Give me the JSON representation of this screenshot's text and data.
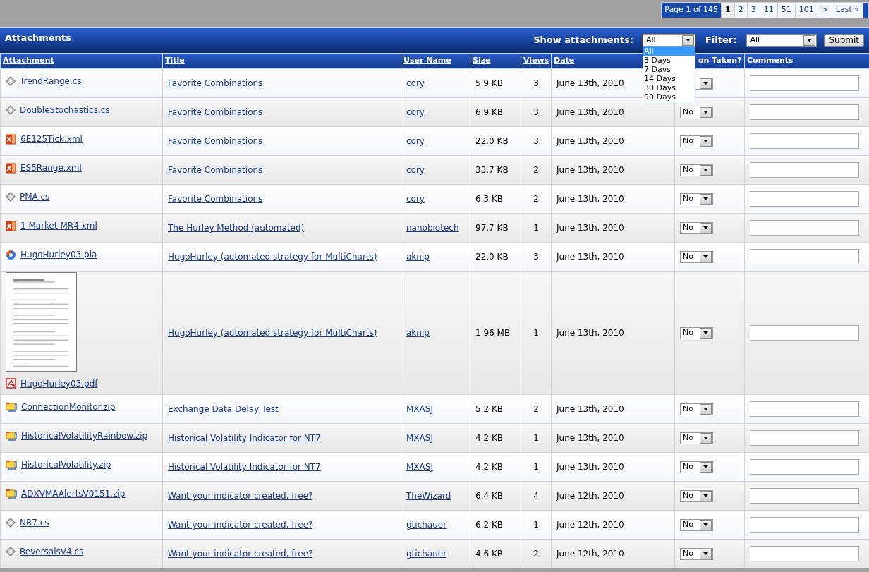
{
  "pagination": {
    "label": "Page 1 of 145",
    "pages": [
      {
        "text": "1",
        "selected": true
      },
      {
        "text": "2",
        "selected": false
      },
      {
        "text": "3",
        "selected": false
      },
      {
        "text": "11",
        "selected": false
      },
      {
        "text": "51",
        "selected": false
      },
      {
        "text": "101",
        "selected": false
      },
      {
        "text": ">",
        "selected": false
      },
      {
        "text": "Last »",
        "selected": false
      }
    ]
  },
  "panel": {
    "title": "Attachments",
    "show_label": "Show attachments:",
    "show_value": "All",
    "show_options": [
      {
        "text": "All",
        "selected": true
      },
      {
        "text": "3 Days",
        "selected": false
      },
      {
        "text": "7 Days",
        "selected": false
      },
      {
        "text": "14 Days",
        "selected": false
      },
      {
        "text": "30 Days",
        "selected": false
      },
      {
        "text": "90 Days",
        "selected": false
      }
    ],
    "filter_label": "Filter:",
    "filter_value": "All",
    "submit": "Submit"
  },
  "table": {
    "columns": [
      {
        "text": "Attachment",
        "link": true
      },
      {
        "text": "Title",
        "link": true
      },
      {
        "text": "User Name",
        "link": true
      },
      {
        "text": "Size",
        "link": true
      },
      {
        "text": "Views",
        "link": true
      },
      {
        "text": "Date",
        "link": true
      },
      {
        "text": "on Taken?",
        "link": false
      },
      {
        "text": "Comments",
        "link": false
      }
    ],
    "rows": [
      {
        "kind": "script",
        "file": "TrendRange.cs",
        "title": "Favorite Combinations",
        "user": "cory",
        "size": "5.9 KB",
        "views": "3",
        "date": "June 13th, 2010"
      },
      {
        "kind": "script",
        "file": "DoubleStochastics.cs",
        "title": "Favorite Combinations",
        "user": "cory",
        "size": "6.9 KB",
        "views": "3",
        "date": "June 13th, 2010",
        "action": "No"
      },
      {
        "kind": "xml",
        "file": "6E125Tick.xml",
        "title": "Favorite Combinations",
        "user": "cory",
        "size": "22.0 KB",
        "views": "3",
        "date": "June 13th, 2010",
        "action": "No"
      },
      {
        "kind": "xml",
        "file": "ES5Range.xml",
        "title": "Favorite Combinations",
        "user": "cory",
        "size": "33.7 KB",
        "views": "2",
        "date": "June 13th, 2010",
        "action": "No"
      },
      {
        "kind": "script",
        "file": "PMA.cs",
        "title": "Favorite Combinations",
        "user": "cory",
        "size": "6.3 KB",
        "views": "2",
        "date": "June 13th, 2010",
        "action": "No"
      },
      {
        "kind": "xml",
        "file": "1 Market MR4.xml",
        "title": "The Hurley Method (automated)",
        "user": "nanobiotech",
        "size": "97.7 KB",
        "views": "1",
        "date": "June 13th, 2010",
        "action": "No"
      },
      {
        "kind": "strategy",
        "file": "HugoHurley03.pla",
        "title": "HugoHurley (automated strategy for MultiCharts)",
        "user": "aknip",
        "size": "22.0 KB",
        "views": "3",
        "date": "June 13th, 2010",
        "action": "No"
      },
      {
        "kind": "pdf",
        "file": "HugoHurley03.pdf",
        "title": "HugoHurley (automated strategy for MultiCharts)",
        "user": "aknip",
        "size": "1.96 MB",
        "views": "1",
        "date": "June 13th, 2010",
        "action": "No"
      },
      {
        "kind": "archive",
        "file": "ConnectionMonitor.zip",
        "title": "Exchange Data Delay Test",
        "user": "MXASJ",
        "size": "5.2 KB",
        "views": "2",
        "date": "June 13th, 2010",
        "action": "No"
      },
      {
        "kind": "archive",
        "file": "HistoricalVolatilityRainbow.zip",
        "title": "Historical Volatility Indicator for NT7",
        "user": "MXASJ",
        "size": "4.2 KB",
        "views": "1",
        "date": "June 13th, 2010",
        "action": "No"
      },
      {
        "kind": "archive",
        "file": "HistoricalVolatility.zip",
        "title": "Historical Volatility Indicator for NT7",
        "user": "MXASJ",
        "size": "4.2 KB",
        "views": "1",
        "date": "June 13th, 2010",
        "action": "No"
      },
      {
        "kind": "archive",
        "file": "ADXVMAAlertsV0151.zip",
        "title": "Want your indicator created, free?",
        "user": "TheWizard",
        "size": "6.4 KB",
        "views": "4",
        "date": "June 12th, 2010",
        "action": "No"
      },
      {
        "kind": "script",
        "file": "NR7.cs",
        "title": "Want your indicator created, free?",
        "user": "gtichauer",
        "size": "6.2 KB",
        "views": "1",
        "date": "June 12th, 2010",
        "action": "No"
      },
      {
        "kind": "script",
        "file": "ReversalsV4.cs",
        "title": "Want your indicator created, free?",
        "user": "gtichauer",
        "size": "4.6 KB",
        "views": "2",
        "date": "June 12th, 2010",
        "action": "No"
      }
    ]
  }
}
